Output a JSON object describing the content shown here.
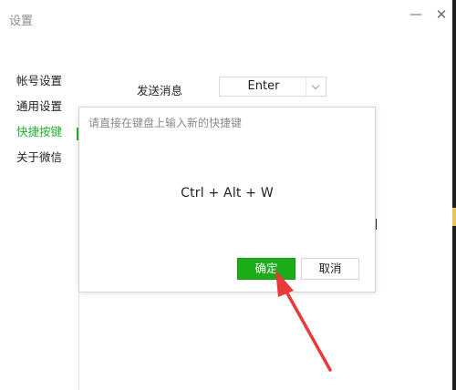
{
  "window": {
    "title": "设置",
    "minimize_glyph": "—",
    "close_glyph": "✕"
  },
  "sidebar": {
    "items": [
      {
        "label": "帐号设置",
        "active": false
      },
      {
        "label": "通用设置",
        "active": false
      },
      {
        "label": "快捷按键",
        "active": true
      },
      {
        "label": "关于微信",
        "active": false
      }
    ]
  },
  "main": {
    "send_message_label": "发送消息",
    "send_message_value": "Enter"
  },
  "dialog": {
    "prompt": "请直接在键盘上输入新的快捷键",
    "shortcut": "Ctrl + Alt + W",
    "ok_label": "确定",
    "cancel_label": "取消"
  },
  "colors": {
    "accent_green": "#1aad19",
    "active_text": "#22b02c",
    "annotation_red": "#e83a3a"
  },
  "annotation": {
    "icon": "red-arrow-pointing-to-ok-button"
  }
}
